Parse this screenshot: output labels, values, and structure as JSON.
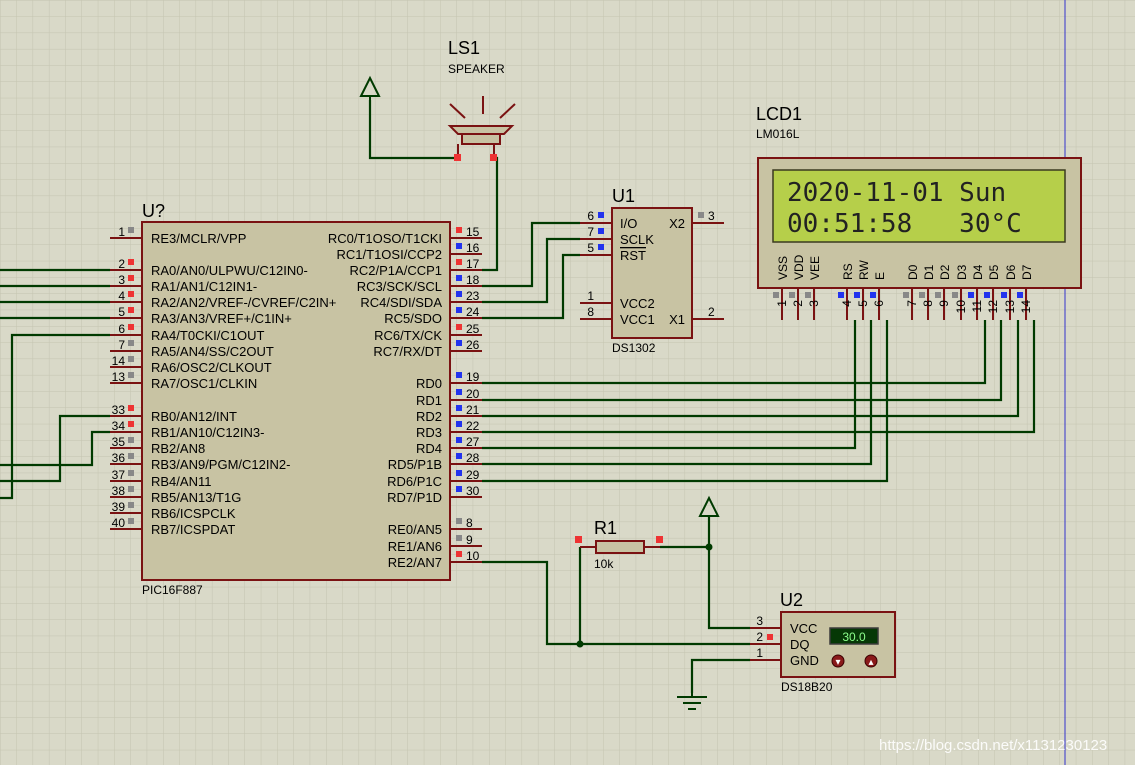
{
  "colors": {
    "background": "#d9d9c8",
    "grid": "#c4c4b0",
    "body_fill": "#c8c3a3",
    "body_stroke": "#7a1212",
    "wire": "#003a00",
    "pin_line": "#7a1212",
    "pin_red": "#ee3333",
    "pin_blue": "#2233ee",
    "pin_gray": "#888888",
    "lcd_screen": "#b6cf4a",
    "meter_bg": "#063806",
    "meter_text": "#8cff8c",
    "margin_line": "#3333cc"
  },
  "icons": [
    "power-arrow-icon",
    "ground-icon",
    "speaker-icon",
    "pin-marker-icon",
    "junction-dot-icon"
  ],
  "components": {
    "mcu": {
      "ref": "U?",
      "part": "PIC16F887",
      "left_pins": [
        {
          "num": "1",
          "name": "RE3/MCLR/VPP",
          "state": "gray"
        },
        {
          "num": "2",
          "name": "RA0/AN0/ULPWU/C12IN0-",
          "state": "red"
        },
        {
          "num": "3",
          "name": "RA1/AN1/C12IN1-",
          "state": "red"
        },
        {
          "num": "4",
          "name": "RA2/AN2/VREF-/CVREF/C2IN+",
          "state": "red"
        },
        {
          "num": "5",
          "name": "RA3/AN3/VREF+/C1IN+",
          "state": "red"
        },
        {
          "num": "6",
          "name": "RA4/T0CKI/C1OUT",
          "state": "red"
        },
        {
          "num": "7",
          "name": "RA5/AN4/SS/C2OUT",
          "state": "gray"
        },
        {
          "num": "14",
          "name": "RA6/OSC2/CLKOUT",
          "state": "gray"
        },
        {
          "num": "13",
          "name": "RA7/OSC1/CLKIN",
          "state": "gray"
        },
        {
          "num": "33",
          "name": "RB0/AN12/INT",
          "state": "red"
        },
        {
          "num": "34",
          "name": "RB1/AN10/C12IN3-",
          "state": "red"
        },
        {
          "num": "35",
          "name": "RB2/AN8",
          "state": "gray"
        },
        {
          "num": "36",
          "name": "RB3/AN9/PGM/C12IN2-",
          "state": "gray"
        },
        {
          "num": "37",
          "name": "RB4/AN11",
          "state": "gray"
        },
        {
          "num": "38",
          "name": "RB5/AN13/T1G",
          "state": "gray"
        },
        {
          "num": "39",
          "name": "RB6/ICSPCLK",
          "state": "gray"
        },
        {
          "num": "40",
          "name": "RB7/ICSPDAT",
          "state": "gray"
        }
      ],
      "right_pins_top": [
        {
          "num": "15",
          "name": "RC0/T1OSO/T1CKI",
          "state": "red"
        },
        {
          "num": "16",
          "name": "RC1/T1OSI/CCP2",
          "state": "blue"
        },
        {
          "num": "17",
          "name": "RC2/P1A/CCP1",
          "state": "red"
        },
        {
          "num": "18",
          "name": "RC3/SCK/SCL",
          "state": "blue"
        },
        {
          "num": "23",
          "name": "RC4/SDI/SDA",
          "state": "blue"
        },
        {
          "num": "24",
          "name": "RC5/SDO",
          "state": "blue"
        },
        {
          "num": "25",
          "name": "RC6/TX/CK",
          "state": "red"
        },
        {
          "num": "26",
          "name": "RC7/RX/DT",
          "state": "blue"
        }
      ],
      "right_pins_mid": [
        {
          "num": "19",
          "name": "RD0",
          "state": "blue"
        },
        {
          "num": "20",
          "name": "RD1",
          "state": "blue"
        },
        {
          "num": "21",
          "name": "RD2",
          "state": "blue"
        },
        {
          "num": "22",
          "name": "RD3",
          "state": "blue"
        },
        {
          "num": "27",
          "name": "RD4",
          "state": "blue"
        },
        {
          "num": "28",
          "name": "RD5/P1B",
          "state": "blue"
        },
        {
          "num": "29",
          "name": "RD6/P1C",
          "state": "blue"
        },
        {
          "num": "30",
          "name": "RD7/P1D",
          "state": "blue"
        }
      ],
      "right_pins_bottom": [
        {
          "num": "8",
          "name": "RE0/AN5",
          "state": "gray"
        },
        {
          "num": "9",
          "name": "RE1/AN6",
          "state": "gray"
        },
        {
          "num": "10",
          "name": "RE2/AN7",
          "state": "red"
        }
      ]
    },
    "rtc": {
      "ref": "U1",
      "part": "DS1302",
      "left_pins": [
        {
          "num": "6",
          "name": "I/O",
          "state": "blue"
        },
        {
          "num": "7",
          "name": "SCLK",
          "state": "blue"
        },
        {
          "num": "5",
          "name": "RST",
          "state": "blue"
        },
        {
          "num": "1",
          "name": "VCC2",
          "state": "none"
        },
        {
          "num": "8",
          "name": "VCC1",
          "state": "none"
        }
      ],
      "right_pins": [
        {
          "num": "3",
          "name": "X2",
          "state": "gray"
        },
        {
          "num": "2",
          "name": "X1",
          "state": "none"
        }
      ]
    },
    "speaker": {
      "ref": "LS1",
      "part": "SPEAKER"
    },
    "lcd": {
      "ref": "LCD1",
      "part": "LM016L",
      "line1": "2020-11-01 Sun",
      "line2": "00:51:58   30°C",
      "pins": [
        {
          "num": "1",
          "name": "VSS",
          "state": "gray"
        },
        {
          "num": "2",
          "name": "VDD",
          "state": "gray"
        },
        {
          "num": "3",
          "name": "VEE",
          "state": "gray"
        },
        {
          "num": "4",
          "name": "RS",
          "state": "blue"
        },
        {
          "num": "5",
          "name": "RW",
          "state": "blue"
        },
        {
          "num": "6",
          "name": "E",
          "state": "blue"
        },
        {
          "num": "7",
          "name": "D0",
          "state": "gray"
        },
        {
          "num": "8",
          "name": "D1",
          "state": "gray"
        },
        {
          "num": "9",
          "name": "D2",
          "state": "gray"
        },
        {
          "num": "10",
          "name": "D3",
          "state": "gray"
        },
        {
          "num": "11",
          "name": "D4",
          "state": "blue"
        },
        {
          "num": "12",
          "name": "D5",
          "state": "blue"
        },
        {
          "num": "13",
          "name": "D6",
          "state": "blue"
        },
        {
          "num": "14",
          "name": "D7",
          "state": "blue"
        }
      ]
    },
    "resistor": {
      "ref": "R1",
      "value": "10k"
    },
    "sensor": {
      "ref": "U2",
      "part": "DS18B20",
      "pins": [
        {
          "num": "3",
          "name": "VCC",
          "state": "none"
        },
        {
          "num": "2",
          "name": "DQ",
          "state": "red"
        },
        {
          "num": "1",
          "name": "GND",
          "state": "none"
        }
      ],
      "reading": "30.0"
    }
  },
  "watermark": "https://blog.csdn.net/x1131230123"
}
